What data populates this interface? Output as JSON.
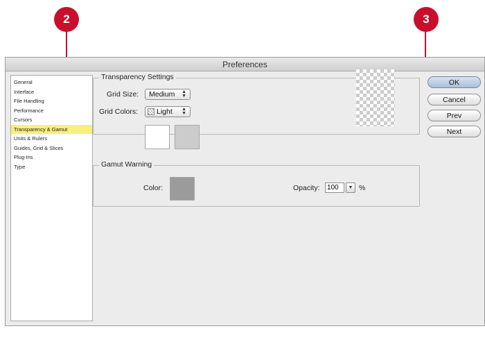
{
  "window": {
    "title": "Preferences"
  },
  "sidebar": {
    "items": [
      {
        "label": "General"
      },
      {
        "label": "Interface"
      },
      {
        "label": "File Handling"
      },
      {
        "label": "Performance"
      },
      {
        "label": "Cursors"
      },
      {
        "label": "Transparency & Gamut",
        "selected": true
      },
      {
        "label": "Units & Rulers"
      },
      {
        "label": "Guides, Grid & Slices"
      },
      {
        "label": "Plug-Ins"
      },
      {
        "label": "Type"
      }
    ]
  },
  "transparency": {
    "title": "Transparency Settings",
    "grid_size_label": "Grid Size:",
    "grid_size_value": "Medium",
    "grid_colors_label": "Grid Colors:",
    "grid_colors_value": "Light",
    "swatch_1_color": "#ffffff",
    "swatch_2_color": "#cccccc"
  },
  "gamut": {
    "title": "Gamut Warning",
    "color_label": "Color:",
    "color_value": "#9b9b9b",
    "opacity_label": "Opacity:",
    "opacity_value": "100",
    "opacity_unit": "%"
  },
  "buttons": {
    "ok": "OK",
    "cancel": "Cancel",
    "prev": "Prev",
    "next": "Next"
  },
  "callouts": {
    "left": "2",
    "right": "3",
    "color": "#c8102e"
  }
}
